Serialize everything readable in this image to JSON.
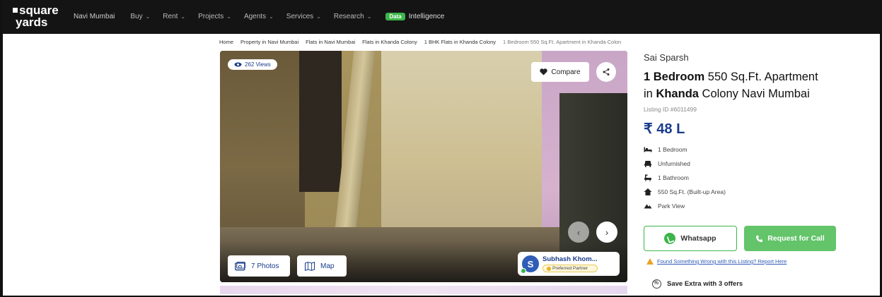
{
  "nav": {
    "logo_line1": "square",
    "logo_line2": "yards",
    "items": [
      "Navi Mumbai",
      "Buy",
      "Rent",
      "Projects",
      "Agents",
      "Services",
      "Research",
      "Data",
      "Intelligence"
    ],
    "badge": "Data",
    "intel": "Intelligence"
  },
  "breadcrumb": [
    "Home",
    "Property in Navi Mumbai",
    "Flats in Navi Mumbai",
    "Flats in Khanda Colony",
    "1 BHK Flats in Khanda Colony",
    "1 Bedroom 550 Sq.Ft. Apartment in Khanda Colon"
  ],
  "gallery": {
    "views": "262 Views",
    "compare": "Compare",
    "photos": "7 Photos",
    "map": "Map",
    "agent_initial": "S",
    "agent_name": "Subhash Khom...",
    "agent_badge": "Preferred Partner"
  },
  "listing": {
    "project": "Sai Sparsh",
    "title_b1": "1 Bedroom",
    "title_r1": " 550 Sq.Ft. Apartment",
    "title_r2_pre": "in ",
    "title_b2": "Khanda",
    "title_r2_post": " Colony Navi Mumbai",
    "listing_id": "Listing ID #6011499",
    "price": "₹ 48 L",
    "features": [
      {
        "icon": "bed-icon",
        "label": "1 Bedroom"
      },
      {
        "icon": "furnishing-icon",
        "label": "Unfurnished"
      },
      {
        "icon": "bath-icon",
        "label": "1 Bathroom"
      },
      {
        "icon": "home-icon",
        "label": "550 Sq.Ft. (Built-up Area)"
      },
      {
        "icon": "view-icon",
        "label": "Park View"
      }
    ]
  },
  "actions": {
    "whatsapp": "Whatsapp",
    "request_call": "Request for Call",
    "report": "Found Something Wrong with this Listing? Report Here",
    "offers": "Save Extra with 3 offers"
  },
  "colors": {
    "brand_blue": "#1a3c8c",
    "green": "#3cb54a",
    "nav_bg": "#141414"
  }
}
